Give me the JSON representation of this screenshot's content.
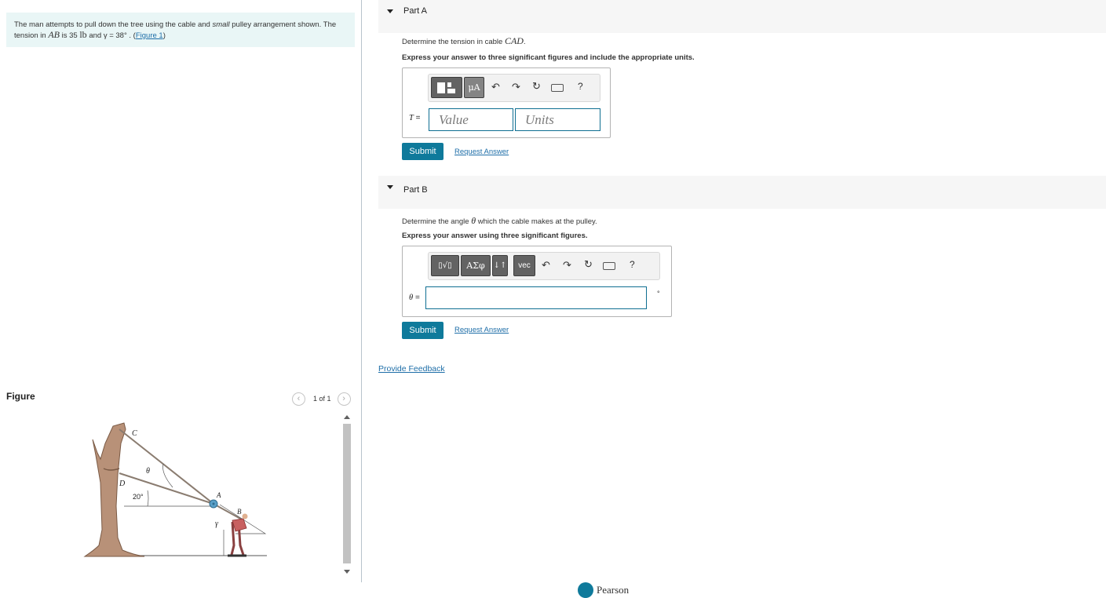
{
  "problem": {
    "text_prefix": "The man attempts to pull down the tree using the cable and ",
    "text_italic": "small",
    "text_mid": " pulley arrangement shown. The tension in ",
    "segment": "AB",
    "text_is": " is 35 ",
    "unit": "lb",
    "text_and": " and γ = 38° . (",
    "figure_link": "Figure 1",
    "text_close": ")"
  },
  "figure": {
    "title": "Figure",
    "counter": "1 of 1",
    "labels": {
      "C": "C",
      "D": "D",
      "A": "A",
      "B": "B",
      "theta": "θ",
      "gamma": "γ",
      "angle": "20°"
    }
  },
  "part_a": {
    "title": "Part A",
    "question_prefix": "Determine the tension in cable ",
    "question_var": "CAD",
    "question_suffix": ".",
    "instruction": "Express your answer to three significant figures and include the appropriate units.",
    "toolbar": {
      "units_btn": "μA",
      "help": "?"
    },
    "var_label": "T",
    "equals": " =",
    "value_placeholder": "Value",
    "units_placeholder": "Units",
    "submit": "Submit",
    "request": "Request Answer"
  },
  "part_b": {
    "title": "Part B",
    "question_prefix": "Determine the angle ",
    "question_var": "θ",
    "question_suffix": " which the cable makes at the pulley.",
    "instruction": "Express your answer using three significant figures.",
    "toolbar": {
      "templates_btn": "▯√▯",
      "greek_btn": "ΑΣφ",
      "arrows_btn": "↓↑",
      "vec_btn": "vec",
      "help": "?"
    },
    "var_label": "θ",
    "equals": " =",
    "unit_symbol": "°",
    "submit": "Submit",
    "request": "Request Answer"
  },
  "feedback": "Provide Feedback",
  "footer": {
    "brand": "Pearson"
  },
  "colors": {
    "accent": "#0f7a9b",
    "link": "#1e6ea8",
    "problem_bg": "#e9f6f6"
  }
}
